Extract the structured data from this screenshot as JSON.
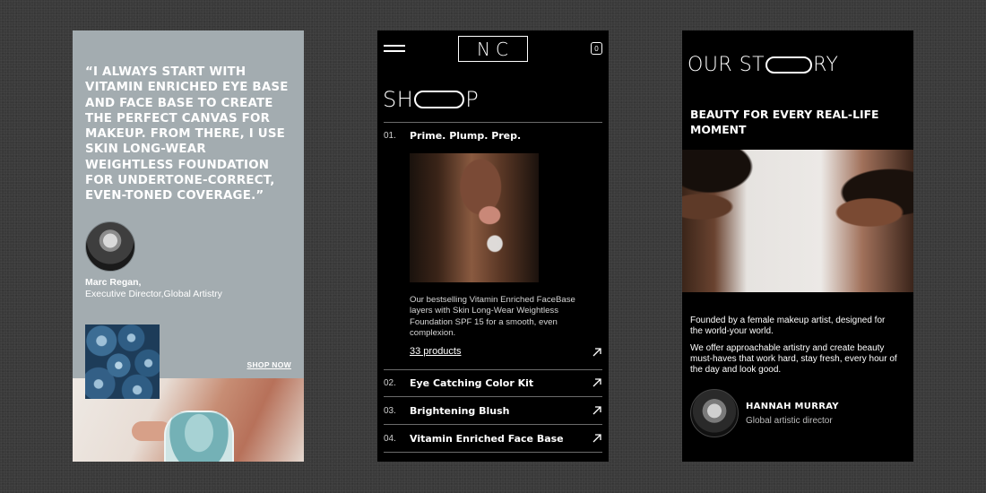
{
  "testimonial": {
    "quote": "“I ALWAYS START WITH VITAMIN ENRICHED EYE BASE AND FACE BASE TO CREATE THE PERFECT CANVAS FOR MAKEUP. FROM THERE, I USE SKIN LONG-WEAR WEIGHTLESS FOUNDATION FOR UNDERTONE-CORRECT, EVEN-TONED COVERAGE.”",
    "author_name": "Marc Regan,",
    "author_role": "Executive Director,Global Artistry",
    "shop_now_label": "SHOP NOW",
    "background_color": "#a3acb0"
  },
  "shop": {
    "logo_text": "NC",
    "bag_count": "0",
    "title_left": "SH",
    "title_right": "P",
    "featured": {
      "number": "01.",
      "label": "Prime. Plump. Prep.",
      "description": "Our bestselling Vitamin Enriched FaceBase layers with Skin Long-Wear Weightless Foundation SPF 15 for a smooth, even complexion.",
      "products_link": "33 products"
    },
    "items": [
      {
        "number": "02.",
        "label": "Eye Catching Color Kit"
      },
      {
        "number": "03.",
        "label": "Brightening Blush"
      },
      {
        "number": "04.",
        "label": "Vitamin Enriched Face Base"
      }
    ]
  },
  "story": {
    "title_left": "OUR ST",
    "title_right": "RY",
    "tagline": "BEAUTY FOR EVERY REAL-LIFE MOMENT",
    "paragraph1": "Founded by a female makeup artist, designed for the world-your world.",
    "paragraph2": "We offer approachable artistry and create beauty must-haves that work hard, stay fresh, every hour of the day and look good.",
    "person_name": "HANNAH MURRAY",
    "person_role": "Global artistic director"
  }
}
